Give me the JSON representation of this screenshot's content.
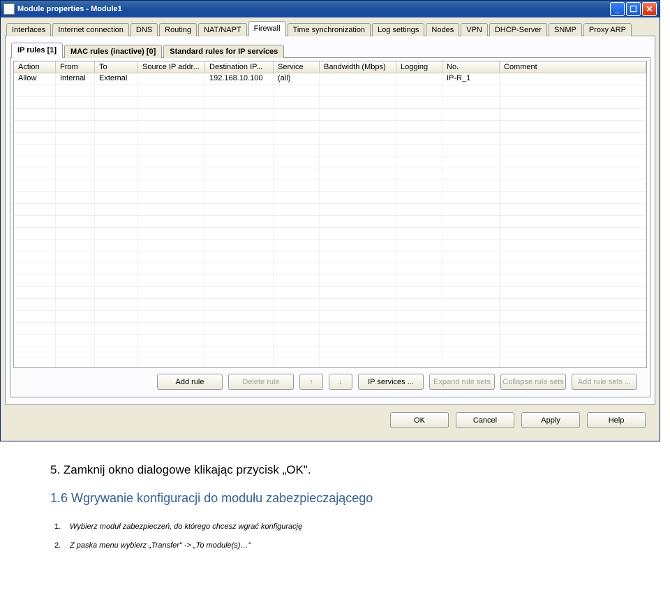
{
  "window": {
    "title": "Module properties - Module1"
  },
  "outer_tabs": [
    "Interfaces",
    "Internet connection",
    "DNS",
    "Routing",
    "NAT/NAPT",
    "Firewall",
    "Time synchronization",
    "Log settings",
    "Nodes",
    "VPN",
    "DHCP-Server",
    "SNMP",
    "Proxy ARP"
  ],
  "outer_active_index": 5,
  "sub_tabs": [
    "IP rules [1]",
    "MAC rules (inactive) [0]",
    "Standard rules for IP services"
  ],
  "sub_active_index": 0,
  "columns": {
    "action": "Action",
    "from": "From",
    "to": "To",
    "src": "Source IP addr...",
    "dst": "Destination IP...",
    "svc": "Service",
    "bw": "Bandwidth (Mbps)",
    "log": "Logging",
    "no": "No.",
    "cmt": "Comment"
  },
  "rows": [
    {
      "action": "Allow",
      "from": "Internal",
      "to": "External",
      "src": "",
      "dst": "192.168.10.100",
      "svc": "(all)",
      "bw": "",
      "log": "",
      "no": "IP-R_1",
      "cmt": ""
    }
  ],
  "empty_row_count": 24,
  "toolbar": {
    "add": "Add rule",
    "delete": "Delete rule",
    "up": "↑",
    "down": "↓",
    "ipsvc": "IP services ...",
    "expand": "Expand rule sets",
    "collapse": "Collapse rule sets",
    "addset": "Add rule sets ..."
  },
  "dialog": {
    "ok": "OK",
    "cancel": "Cancel",
    "apply": "Apply",
    "help": "Help"
  },
  "doc": {
    "step5": "5.   Zamknij okno dialogowe klikając przycisk „OK\".",
    "heading": "1.6 Wgrywanie konfiguracji do modułu zabezpieczającego",
    "sub1_num": "1.",
    "sub1": "Wybierz moduł zabezpieczeń, do którego chcesz wgrać konfigurację",
    "sub2_num": "2.",
    "sub2": "Z paska menu wybierz „Transfer\" -> „To module(s)…\""
  }
}
